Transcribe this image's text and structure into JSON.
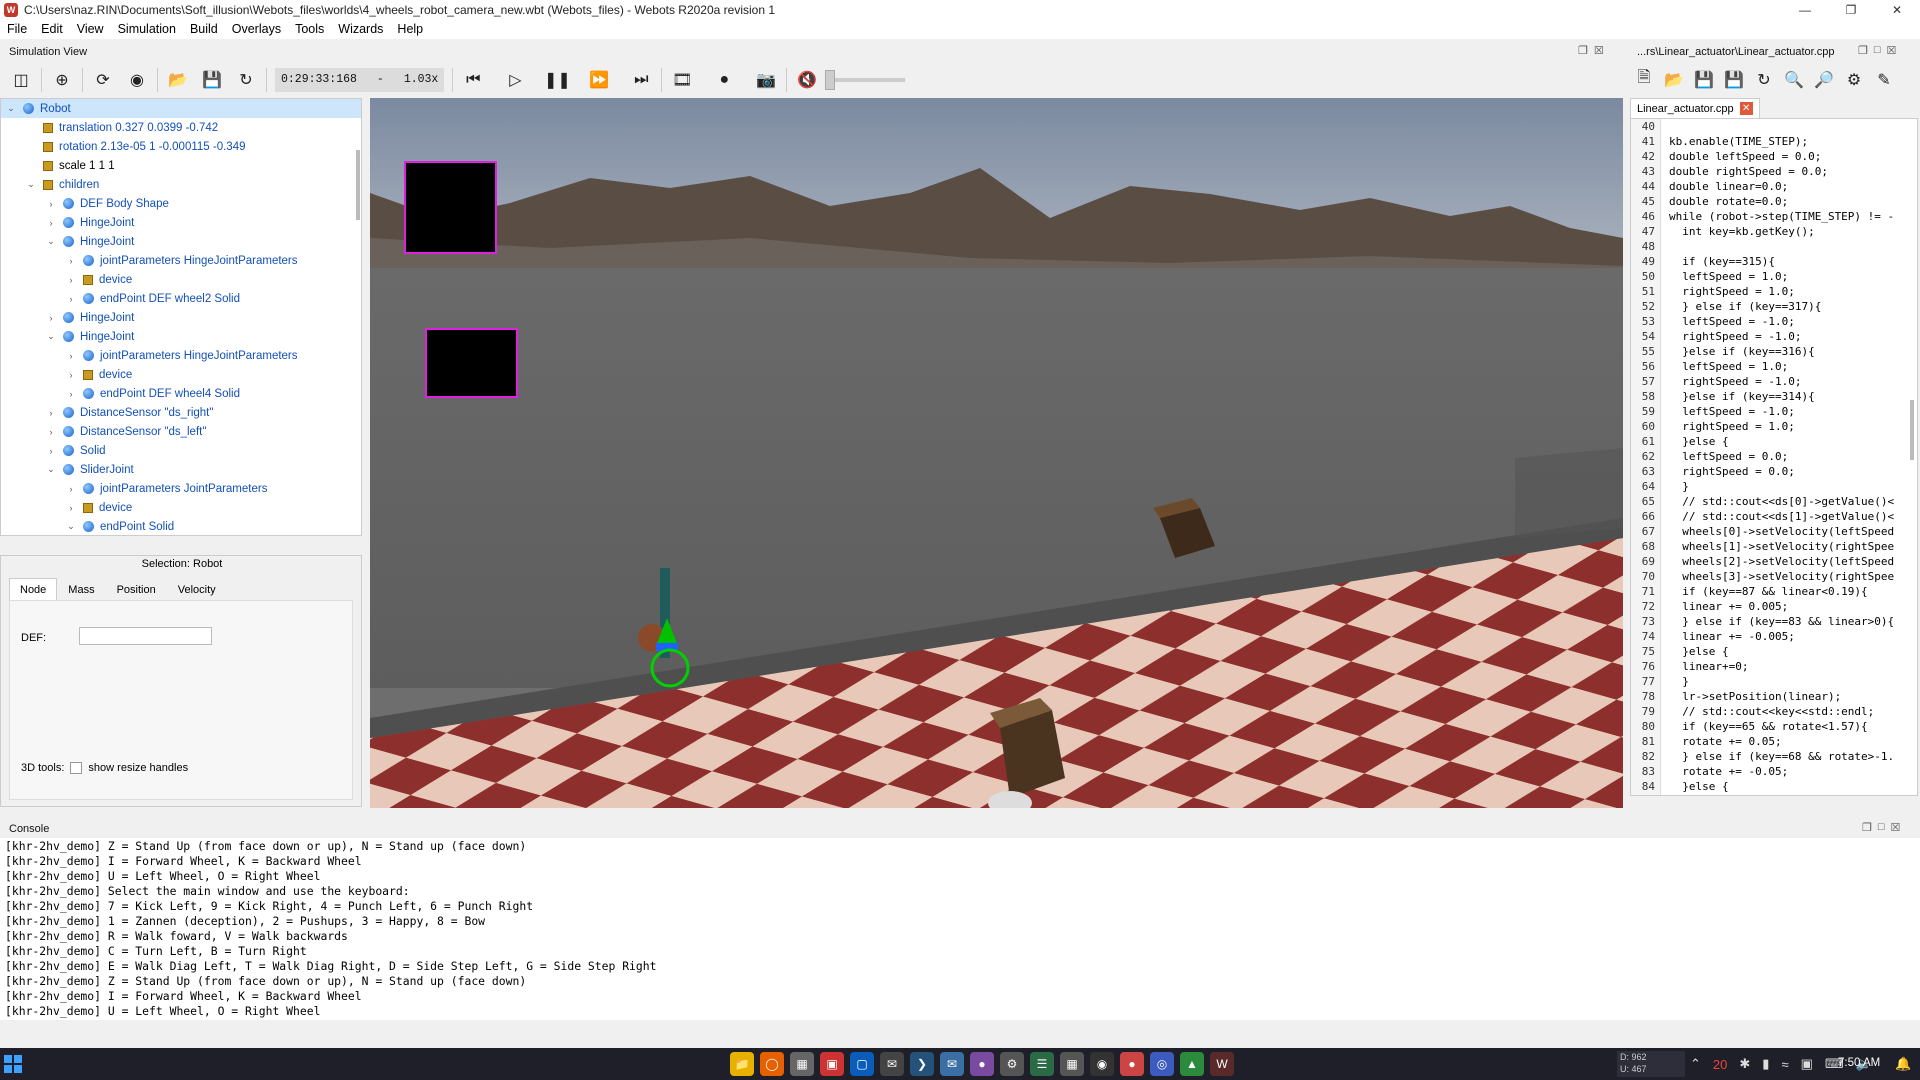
{
  "window": {
    "title": "C:\\Users\\naz.RIN\\Documents\\Soft_illusion\\Webots_files\\worlds\\4_wheels_robot_camera_new.wbt (Webots_files) - Webots R2020a revision 1"
  },
  "menu": [
    "File",
    "Edit",
    "View",
    "Simulation",
    "Build",
    "Overlays",
    "Tools",
    "Wizards",
    "Help"
  ],
  "simulation_view": {
    "title": "Simulation View",
    "time": "0:29:33:168",
    "dash": "-",
    "speed": "1.03x"
  },
  "editor": {
    "panel_title": "...rs\\Linear_actuator\\Linear_actuator.cpp",
    "tab_label": "Linear_actuator.cpp",
    "lines": [
      {
        "n": "40",
        "t": ""
      },
      {
        "n": "41",
        "t": "kb.enable(TIME_STEP);"
      },
      {
        "n": "42",
        "t": "double leftSpeed = 0.0;"
      },
      {
        "n": "43",
        "t": "double rightSpeed = 0.0;"
      },
      {
        "n": "44",
        "t": "double linear=0.0;"
      },
      {
        "n": "45",
        "t": "double rotate=0.0;"
      },
      {
        "n": "46",
        "t": "while (robot->step(TIME_STEP) != -"
      },
      {
        "n": "47",
        "t": "  int key=kb.getKey();"
      },
      {
        "n": "48",
        "t": ""
      },
      {
        "n": "49",
        "t": "  if (key==315){"
      },
      {
        "n": "50",
        "t": "  leftSpeed = 1.0;"
      },
      {
        "n": "51",
        "t": "  rightSpeed = 1.0;"
      },
      {
        "n": "52",
        "t": "  } else if (key==317){"
      },
      {
        "n": "53",
        "t": "  leftSpeed = -1.0;"
      },
      {
        "n": "54",
        "t": "  rightSpeed = -1.0;"
      },
      {
        "n": "55",
        "t": "  }else if (key==316){"
      },
      {
        "n": "56",
        "t": "  leftSpeed = 1.0;"
      },
      {
        "n": "57",
        "t": "  rightSpeed = -1.0;"
      },
      {
        "n": "58",
        "t": "  }else if (key==314){"
      },
      {
        "n": "59",
        "t": "  leftSpeed = -1.0;"
      },
      {
        "n": "60",
        "t": "  rightSpeed = 1.0;"
      },
      {
        "n": "61",
        "t": "  }else {"
      },
      {
        "n": "62",
        "t": "  leftSpeed = 0.0;"
      },
      {
        "n": "63",
        "t": "  rightSpeed = 0.0;"
      },
      {
        "n": "64",
        "t": "  }"
      },
      {
        "n": "65",
        "t": "  // std::cout<<ds[0]->getValue()<"
      },
      {
        "n": "66",
        "t": "  // std::cout<<ds[1]->getValue()<"
      },
      {
        "n": "67",
        "t": "  wheels[0]->setVelocity(leftSpeed"
      },
      {
        "n": "68",
        "t": "  wheels[1]->setVelocity(rightSpee"
      },
      {
        "n": "69",
        "t": "  wheels[2]->setVelocity(leftSpeed"
      },
      {
        "n": "70",
        "t": "  wheels[3]->setVelocity(rightSpee"
      },
      {
        "n": "71",
        "t": "  if (key==87 && linear<0.19){"
      },
      {
        "n": "72",
        "t": "  linear += 0.005;"
      },
      {
        "n": "73",
        "t": "  } else if (key==83 && linear>0){"
      },
      {
        "n": "74",
        "t": "  linear += -0.005;"
      },
      {
        "n": "75",
        "t": "  }else {"
      },
      {
        "n": "76",
        "t": "  linear+=0;"
      },
      {
        "n": "77",
        "t": "  }"
      },
      {
        "n": "78",
        "t": "  lr->setPosition(linear);"
      },
      {
        "n": "79",
        "t": "  // std::cout<<key<<std::endl;"
      },
      {
        "n": "80",
        "t": "  if (key==65 && rotate<1.57){"
      },
      {
        "n": "81",
        "t": "  rotate += 0.05;"
      },
      {
        "n": "82",
        "t": "  } else if (key==68 && rotate>-1."
      },
      {
        "n": "83",
        "t": "  rotate += -0.05;"
      },
      {
        "n": "84",
        "t": "  }else {"
      }
    ]
  },
  "scene_tree": [
    {
      "depth": 0,
      "arrow": "v",
      "icon": "dot",
      "text": "Robot",
      "sel": true
    },
    {
      "depth": 1,
      "arrow": "",
      "icon": "sq",
      "text": "translation 0.327 0.0399 -0.742"
    },
    {
      "depth": 1,
      "arrow": "",
      "icon": "sq",
      "text": "rotation 2.13e-05 1 -0.000115 -0.349"
    },
    {
      "depth": 1,
      "arrow": "",
      "icon": "sq",
      "text": "scale 1 1 1",
      "black": true
    },
    {
      "depth": 1,
      "arrow": "v",
      "icon": "sq",
      "text": "children"
    },
    {
      "depth": 2,
      "arrow": ">",
      "icon": "dot",
      "text": "DEF Body Shape"
    },
    {
      "depth": 2,
      "arrow": ">",
      "icon": "dot",
      "text": "HingeJoint"
    },
    {
      "depth": 2,
      "arrow": "v",
      "icon": "dot",
      "text": "HingeJoint"
    },
    {
      "depth": 3,
      "arrow": ">",
      "icon": "dot",
      "text": "jointParameters HingeJointParameters"
    },
    {
      "depth": 3,
      "arrow": ">",
      "icon": "sq",
      "text": "device"
    },
    {
      "depth": 3,
      "arrow": ">",
      "icon": "dot",
      "text": "endPoint DEF wheel2 Solid"
    },
    {
      "depth": 2,
      "arrow": ">",
      "icon": "dot",
      "text": "HingeJoint"
    },
    {
      "depth": 2,
      "arrow": "v",
      "icon": "dot",
      "text": "HingeJoint"
    },
    {
      "depth": 3,
      "arrow": ">",
      "icon": "dot",
      "text": "jointParameters HingeJointParameters"
    },
    {
      "depth": 3,
      "arrow": ">",
      "icon": "sq",
      "text": "device"
    },
    {
      "depth": 3,
      "arrow": ">",
      "icon": "dot",
      "text": "endPoint DEF wheel4 Solid"
    },
    {
      "depth": 2,
      "arrow": ">",
      "icon": "dot",
      "text": "DistanceSensor \"ds_right\""
    },
    {
      "depth": 2,
      "arrow": ">",
      "icon": "dot",
      "text": "DistanceSensor \"ds_left\""
    },
    {
      "depth": 2,
      "arrow": ">",
      "icon": "dot",
      "text": "Solid"
    },
    {
      "depth": 2,
      "arrow": "v",
      "icon": "dot",
      "text": "SliderJoint"
    },
    {
      "depth": 3,
      "arrow": ">",
      "icon": "dot",
      "text": "jointParameters JointParameters"
    },
    {
      "depth": 3,
      "arrow": ">",
      "icon": "sq",
      "text": "device"
    },
    {
      "depth": 3,
      "arrow": "v",
      "icon": "dot",
      "text": "endPoint Solid"
    }
  ],
  "properties": {
    "selection": "Selection: Robot",
    "tabs": [
      "Node",
      "Mass",
      "Position",
      "Velocity"
    ],
    "def_label": "DEF:",
    "def_value": "",
    "tools_label": "3D tools:",
    "resize_label": "show resize handles"
  },
  "console": {
    "title": "Console",
    "lines": [
      "[khr-2hv_demo] Z = Stand Up (from face down or up), N = Stand up (face down)",
      "[khr-2hv_demo] I = Forward Wheel, K = Backward Wheel",
      "[khr-2hv_demo] U = Left Wheel, O = Right Wheel",
      "[khr-2hv_demo] Select the main window and use the keyboard:",
      "[khr-2hv_demo] 7 = Kick Left, 9 = Kick Right, 4 = Punch Left, 6 = Punch Right",
      "[khr-2hv_demo] 1 = Zannen (deception), 2 = Pushups, 3 = Happy, 8 = Bow",
      "[khr-2hv_demo] R = Walk foward, V = Walk backwards",
      "[khr-2hv_demo] C = Turn Left, B = Turn Right",
      "[khr-2hv_demo] E = Walk Diag Left, T = Walk Diag Right, D = Side Step Left, G = Side Step Right",
      "[khr-2hv_demo] Z = Stand Up (from face down or up), N = Stand up (face down)",
      "[khr-2hv_demo] I = Forward Wheel, K = Backward Wheel",
      "[khr-2hv_demo] U = Left Wheel, O = Right Wheel"
    ]
  },
  "taskbar": {
    "net_down": "D: 962",
    "net_up": "U: 467",
    "badge": "20",
    "time": "7:50 AM"
  }
}
